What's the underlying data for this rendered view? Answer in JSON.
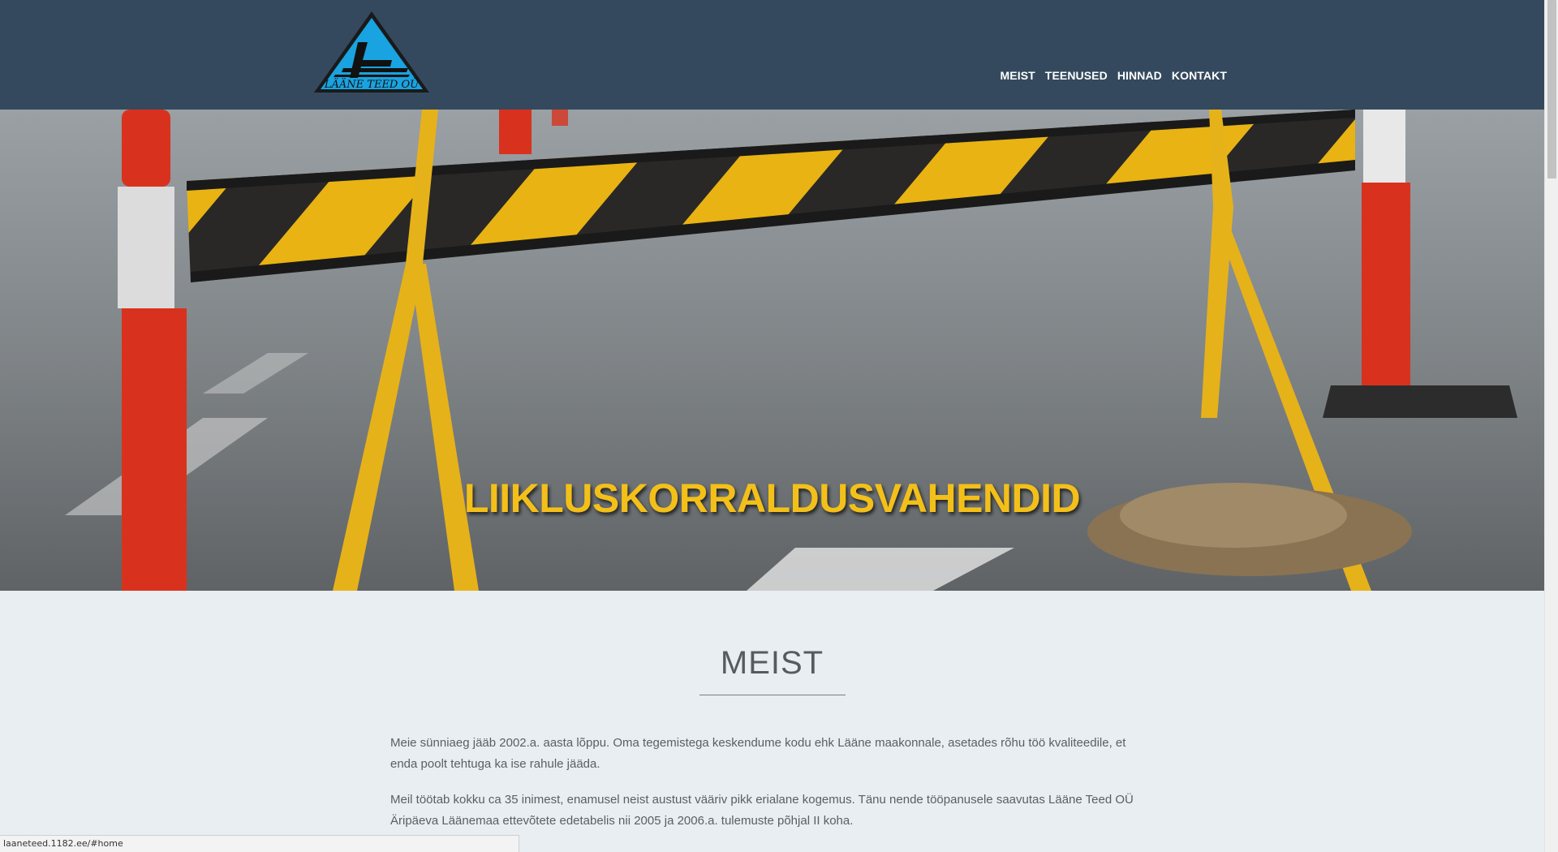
{
  "header": {
    "logo_text": "LÄÄNE TEED OÜ",
    "nav": [
      {
        "label": "MEIST"
      },
      {
        "label": "TEENUSED"
      },
      {
        "label": "HINNAD"
      },
      {
        "label": "KONTAKT"
      }
    ]
  },
  "hero": {
    "title": "LIIKLUSKORRALDUSVAHENDID"
  },
  "about": {
    "title": "MEIST",
    "paragraphs": [
      "Meie sünniaeg jääb 2002.a. aasta lõppu. Oma tegemistega keskendume kodu ehk Lääne maakonnale, asetades rõhu töö kvaliteedile, et enda poolt tehtuga ka ise rahule jääda.",
      "Meil töötab kokku ca 35 inimest, enamusel neist austust vääriv pikk erialane kogemus. Tänu nende tööpanusele saavutas Lääne Teed OÜ Äripäeva Läänemaa ettevõtete edetabelis nii 2005 ja 2006.a. tulemuste põhjal II koha."
    ]
  },
  "statusbar": {
    "url": "laaneteed.1182.ee/#home"
  },
  "colors": {
    "header_bg": "#34495e",
    "accent_yellow": "#f3c01a",
    "content_bg": "#e8eef1"
  }
}
